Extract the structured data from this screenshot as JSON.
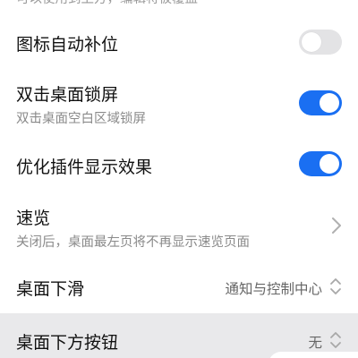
{
  "rows": {
    "partial": {
      "title": "可以使用到上方，编辑将被覆盖"
    },
    "icon_auto_fill": {
      "title": "图标自动补位",
      "enabled": false
    },
    "double_tap_lock": {
      "title": "双击桌面锁屏",
      "subtitle": "双击桌面空白区域锁屏",
      "enabled": true
    },
    "optimize_widgets": {
      "title": "优化插件显示效果",
      "enabled": true
    },
    "overview": {
      "title": "速览",
      "subtitle": "关闭后，桌面最左页将不再显示速览页面"
    },
    "swipe_down": {
      "title": "桌面下滑",
      "value": "通知与控制中心"
    },
    "bottom_button": {
      "title": "桌面下方按钮",
      "value": "无"
    }
  },
  "icons": {
    "chevron": "chevron-right-icon",
    "selector": "up-down-arrows-icon"
  },
  "colors": {
    "accent": "#1a6ff2",
    "toggle_off": "#e3e3e5",
    "secondary_text": "#8a8a8a"
  }
}
